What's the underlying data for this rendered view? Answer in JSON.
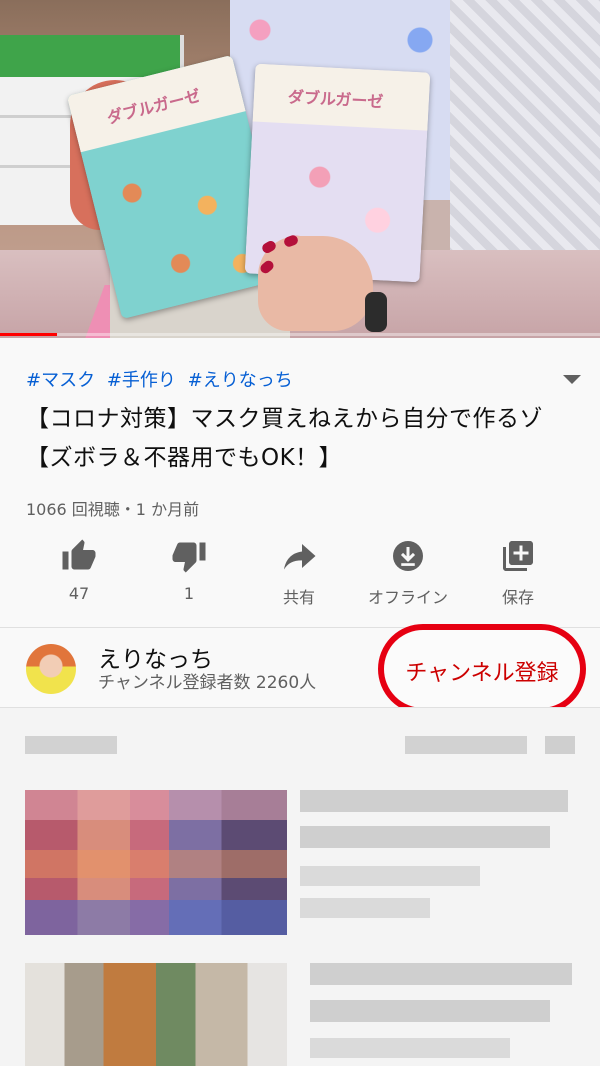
{
  "player": {
    "progress_fraction": 0.095,
    "package_label": "ダブルガーゼ"
  },
  "video": {
    "hashtags": [
      "#マスク",
      "#手作り",
      "#えりなっち"
    ],
    "title": "【コロナ対策】マスク買えねえから自分で作るゾ【ズボラ＆不器用でもOK！】",
    "meta": "1066 回視聴・1 か月前"
  },
  "actions": {
    "like": "47",
    "dislike": "1",
    "share": "共有",
    "offline": "オフライン",
    "save": "保存"
  },
  "channel": {
    "name": "えりなっち",
    "subscribers": "チャンネル登録者数 2260人",
    "subscribe_label": "チャンネル登録"
  },
  "colors": {
    "accent_red": "#ff0000",
    "subscribe_outline": "#e60012",
    "hashtag_blue": "#065fd4",
    "text_secondary": "#606060"
  },
  "icons": {
    "like": "thumbs-up-icon",
    "dislike": "thumbs-down-icon",
    "share": "share-arrow-icon",
    "offline": "download-icon",
    "save": "playlist-add-icon",
    "expand": "chevron-down-icon"
  }
}
